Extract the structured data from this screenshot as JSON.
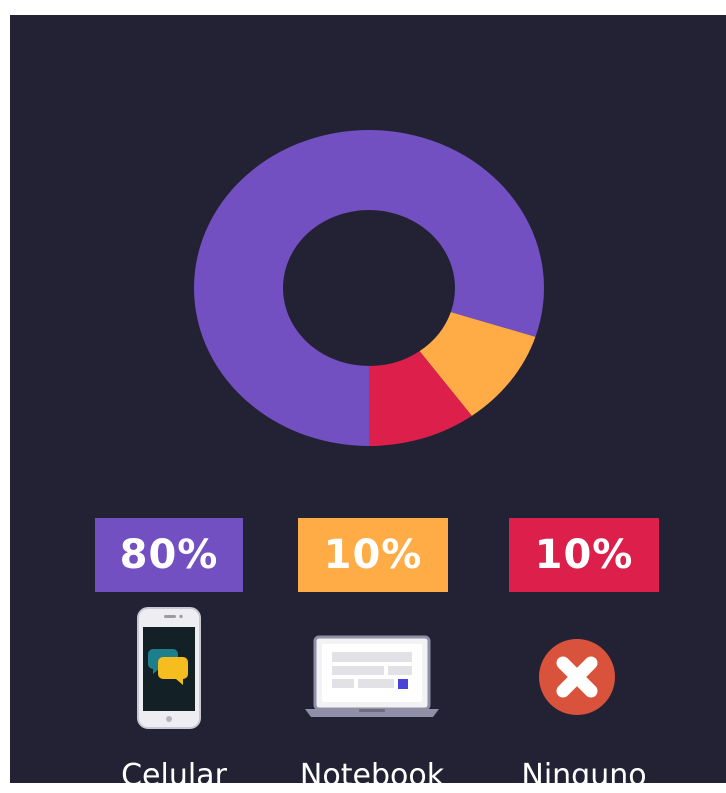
{
  "chart_data": {
    "type": "pie",
    "categories": [
      "Celular",
      "Notebook",
      "Ninguno"
    ],
    "values": [
      80,
      10,
      10
    ],
    "labels": [
      "80%",
      "10%",
      "10%"
    ],
    "colors": [
      "#7350C2",
      "#FFAC47",
      "#DC1F4B"
    ]
  },
  "legend": [
    {
      "label": "Celular",
      "value_label": "80%",
      "color": "#7350C2",
      "icon": "smartphone-chat-icon"
    },
    {
      "label": "Notebook",
      "value_label": "10%",
      "color": "#FFAC47",
      "icon": "laptop-icon"
    },
    {
      "label": "Ninguno",
      "value_label": "10%",
      "color": "#DC1F4B",
      "icon": "close-circle-icon"
    }
  ],
  "background_color": "#232235"
}
